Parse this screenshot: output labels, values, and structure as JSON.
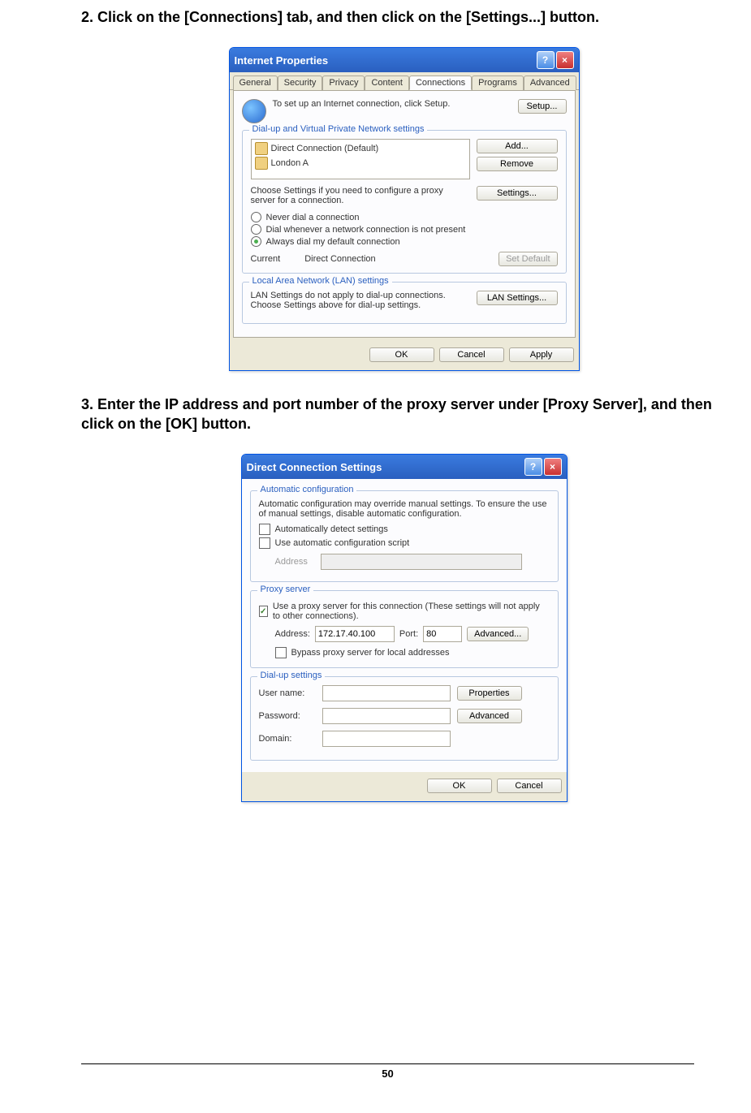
{
  "instruction1": "2. Click on the [Connections] tab, and then click on the [Settings...] button.",
  "instruction2": "3. Enter the IP address and port number of the proxy server under [Proxy Server], and then click on the [OK] button.",
  "page_number": "50",
  "dialog1": {
    "title": "Internet Properties",
    "tabs": [
      "General",
      "Security",
      "Privacy",
      "Content",
      "Connections",
      "Programs",
      "Advanced"
    ],
    "active_tab": 4,
    "setup_text": "To set up an Internet connection, click Setup.",
    "setup_btn": "Setup...",
    "dialvpn": {
      "legend": "Dial-up and Virtual Private Network settings",
      "items": [
        "Direct Connection (Default)",
        "London A"
      ],
      "add_btn": "Add...",
      "remove_btn": "Remove",
      "choose_text": "Choose Settings if you need to configure a proxy server for a connection.",
      "settings_btn": "Settings...",
      "radio_never": "Never dial a connection",
      "radio_when": "Dial whenever a network connection is not present",
      "radio_always": "Always dial my default connection",
      "current_label": "Current",
      "current_value": "Direct Connection",
      "setdefault_btn": "Set Default"
    },
    "lan": {
      "legend": "Local Area Network (LAN) settings",
      "text": "LAN Settings do not apply to dial-up connections. Choose Settings above for dial-up settings.",
      "btn": "LAN Settings..."
    },
    "ok_btn": "OK",
    "cancel_btn": "Cancel",
    "apply_btn": "Apply"
  },
  "dialog2": {
    "title": "Direct Connection Settings",
    "autoconfig": {
      "legend": "Automatic configuration",
      "text": "Automatic configuration may override manual settings.  To ensure the use of manual settings, disable automatic configuration.",
      "check_detect": "Automatically detect settings",
      "check_script": "Use automatic configuration script",
      "address_label": "Address"
    },
    "proxy": {
      "legend": "Proxy server",
      "check_use": "Use a proxy server for this connection (These settings will not apply to other connections).",
      "address_label": "Address:",
      "address_value": "172.17.40.100",
      "port_label": "Port:",
      "port_value": "80",
      "advanced_btn": "Advanced...",
      "check_bypass": "Bypass proxy server for local addresses"
    },
    "dialup": {
      "legend": "Dial-up settings",
      "user_label": "User name:",
      "pass_label": "Password:",
      "domain_label": "Domain:",
      "props_btn": "Properties",
      "adv_btn": "Advanced"
    },
    "ok_btn": "OK",
    "cancel_btn": "Cancel"
  }
}
